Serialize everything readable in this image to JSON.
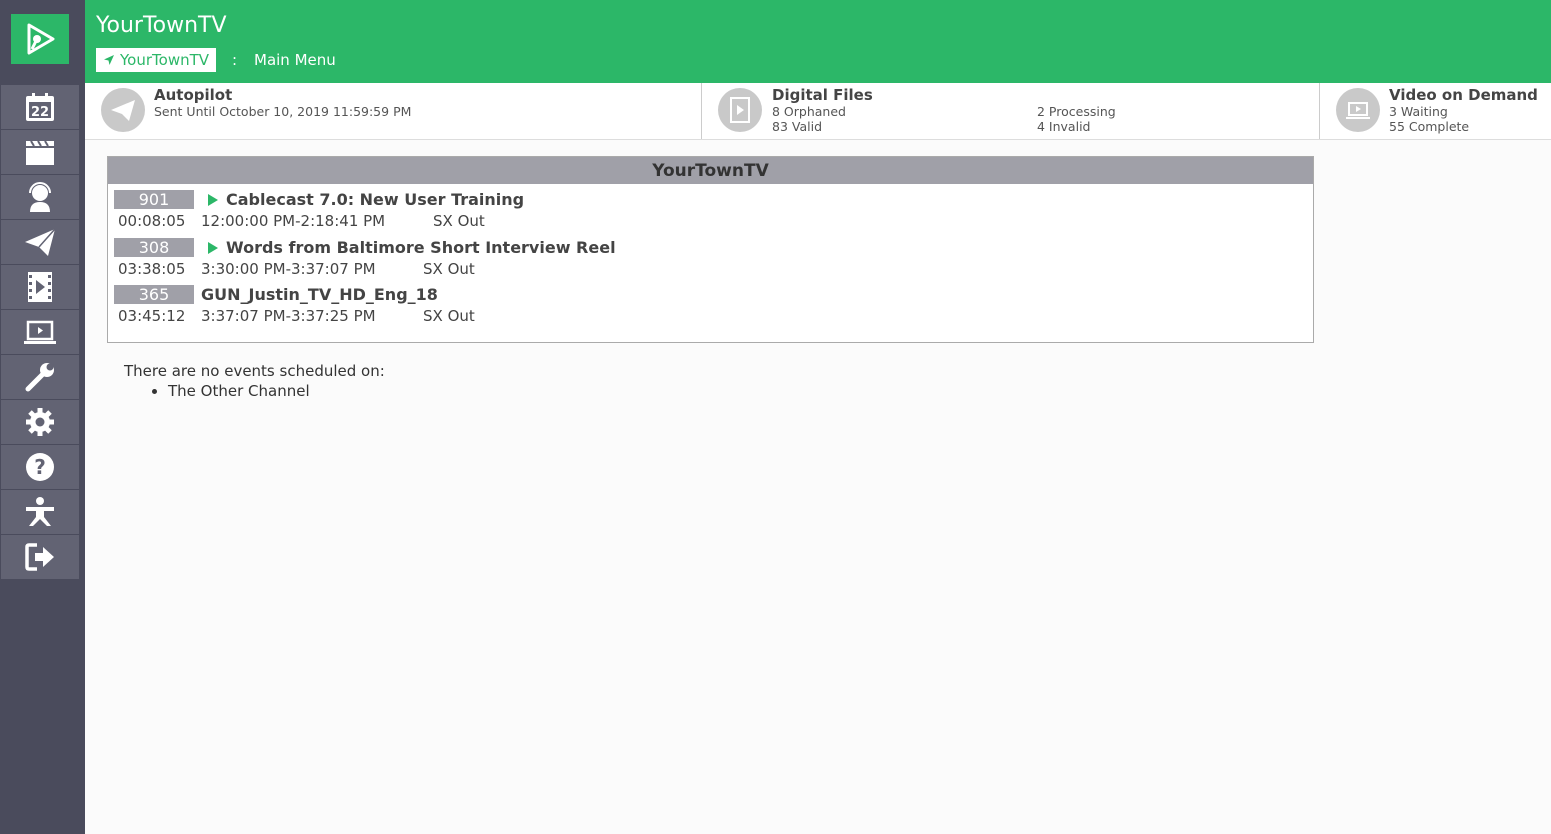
{
  "app": {
    "title": "YourTownTV"
  },
  "breadcrumb": {
    "home": "YourTownTV",
    "separator": ":",
    "current": "Main Menu"
  },
  "sidebar": {
    "items": [
      {
        "icon": "calendar-icon",
        "day": "22"
      },
      {
        "icon": "clapperboard-icon"
      },
      {
        "icon": "headset-user-icon"
      },
      {
        "icon": "paper-plane-icon"
      },
      {
        "icon": "film-play-icon"
      },
      {
        "icon": "laptop-play-icon"
      },
      {
        "icon": "wrench-icon"
      },
      {
        "icon": "gear-icon"
      },
      {
        "icon": "help-icon"
      },
      {
        "icon": "admin-person-icon"
      },
      {
        "icon": "sign-out-icon"
      }
    ]
  },
  "status": {
    "autopilot": {
      "title": "Autopilot",
      "line1": "Sent Until October 10, 2019 11:59:59 PM"
    },
    "digital_files": {
      "title": "Digital Files",
      "orphaned": "8 Orphaned",
      "valid": "83 Valid",
      "processing": "2 Processing",
      "invalid": "4 Invalid"
    },
    "vod": {
      "title": "Video on Demand",
      "waiting": "3 Waiting",
      "complete": "55 Complete"
    }
  },
  "schedule": {
    "channel": "YourTownTV",
    "events": [
      {
        "number": "901",
        "title": "Cablecast 7.0: New User Training",
        "has_play": true,
        "duration": "00:08:05",
        "time": "12:00:00 PM-2:18:41 PM",
        "output": "SX Out"
      },
      {
        "number": "308",
        "title": "Words from Baltimore Short Interview Reel",
        "has_play": true,
        "duration": "03:38:05",
        "time": "3:30:00 PM-3:37:07 PM",
        "output": "SX Out"
      },
      {
        "number": "365",
        "title": "GUN_Justin_TV_HD_Eng_18",
        "has_play": false,
        "duration": "03:45:12",
        "time": "3:37:07 PM-3:37:25 PM",
        "output": "SX Out"
      }
    ]
  },
  "no_events": {
    "message": "There are no events scheduled on:",
    "channels": [
      "The Other Channel"
    ]
  },
  "colors": {
    "brand_green": "#2cb768",
    "sidebar": "#4a4b5c",
    "sidebar_item": "#626373",
    "event_badge": "#a0a0a8"
  }
}
